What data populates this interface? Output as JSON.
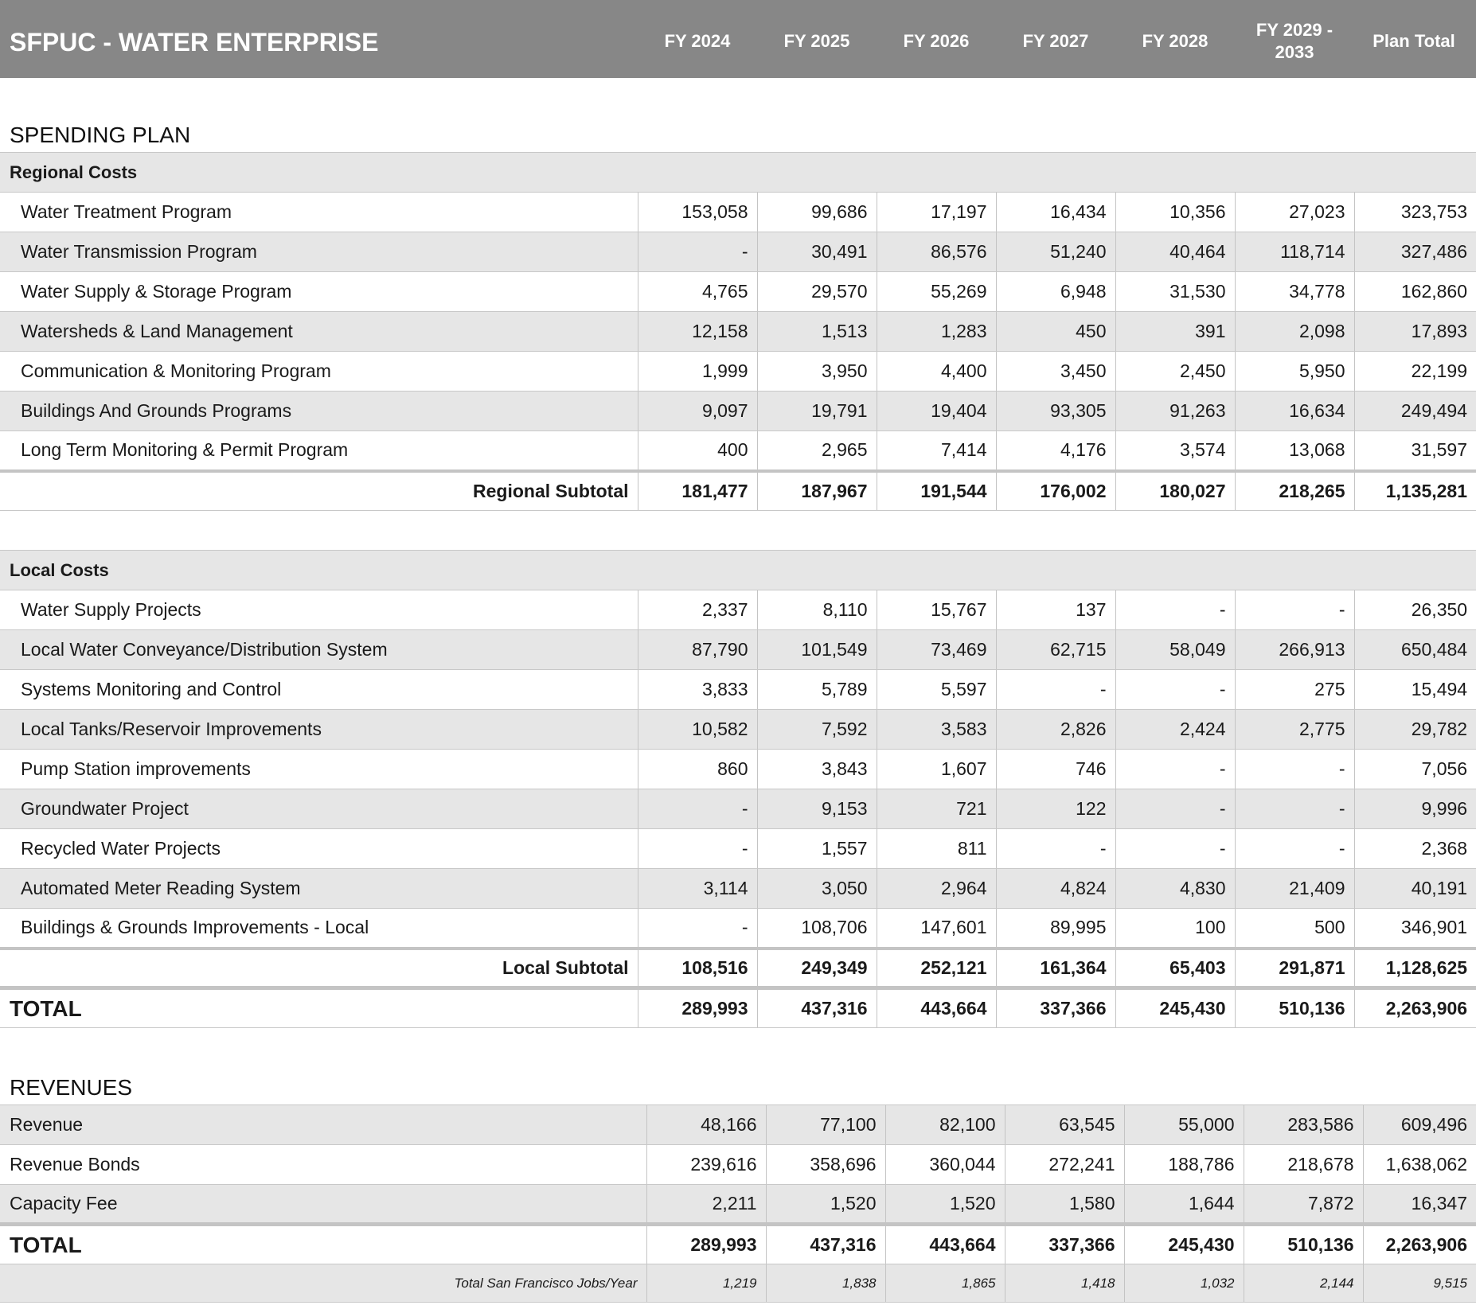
{
  "header": {
    "title": "SFPUC - WATER ENTERPRISE",
    "years": [
      "FY 2024",
      "FY 2025",
      "FY 2026",
      "FY 2027",
      "FY 2028",
      "FY 2029 - 2033",
      "Plan Total"
    ]
  },
  "spending": {
    "title": "SPENDING PLAN",
    "regional": {
      "heading": "Regional Costs",
      "rows": [
        {
          "label": "Water Treatment Program",
          "values": [
            "153,058",
            "99,686",
            "17,197",
            "16,434",
            "10,356",
            "27,023",
            "323,753"
          ]
        },
        {
          "label": "Water Transmission Program",
          "values": [
            "-",
            "30,491",
            "86,576",
            "51,240",
            "40,464",
            "118,714",
            "327,486"
          ]
        },
        {
          "label": "Water Supply & Storage Program",
          "values": [
            "4,765",
            "29,570",
            "55,269",
            "6,948",
            "31,530",
            "34,778",
            "162,860"
          ]
        },
        {
          "label": "Watersheds & Land Management",
          "values": [
            "12,158",
            "1,513",
            "1,283",
            "450",
            "391",
            "2,098",
            "17,893"
          ]
        },
        {
          "label": "Communication & Monitoring Program",
          "values": [
            "1,999",
            "3,950",
            "4,400",
            "3,450",
            "2,450",
            "5,950",
            "22,199"
          ]
        },
        {
          "label": "Buildings And Grounds Programs",
          "values": [
            "9,097",
            "19,791",
            "19,404",
            "93,305",
            "91,263",
            "16,634",
            "249,494"
          ]
        },
        {
          "label": "Long Term Monitoring & Permit Program",
          "values": [
            "400",
            "2,965",
            "7,414",
            "4,176",
            "3,574",
            "13,068",
            "31,597"
          ]
        }
      ],
      "subtotal": {
        "label": "Regional Subtotal",
        "values": [
          "181,477",
          "187,967",
          "191,544",
          "176,002",
          "180,027",
          "218,265",
          "1,135,281"
        ]
      }
    },
    "local": {
      "heading": "Local Costs",
      "rows": [
        {
          "label": "Water Supply Projects",
          "values": [
            "2,337",
            "8,110",
            "15,767",
            "137",
            "-",
            "-",
            "26,350"
          ]
        },
        {
          "label": "Local Water Conveyance/Distribution System",
          "values": [
            "87,790",
            "101,549",
            "73,469",
            "62,715",
            "58,049",
            "266,913",
            "650,484"
          ]
        },
        {
          "label": "Systems Monitoring and Control",
          "values": [
            "3,833",
            "5,789",
            "5,597",
            "-",
            "-",
            "275",
            "15,494"
          ]
        },
        {
          "label": "Local Tanks/Reservoir Improvements",
          "values": [
            "10,582",
            "7,592",
            "3,583",
            "2,826",
            "2,424",
            "2,775",
            "29,782"
          ]
        },
        {
          "label": "Pump Station improvements",
          "values": [
            "860",
            "3,843",
            "1,607",
            "746",
            "-",
            "-",
            "7,056"
          ]
        },
        {
          "label": "Groundwater Project",
          "values": [
            "-",
            "9,153",
            "721",
            "122",
            "-",
            "-",
            "9,996"
          ]
        },
        {
          "label": "Recycled Water Projects",
          "values": [
            "-",
            "1,557",
            "811",
            "-",
            "-",
            "-",
            "2,368"
          ]
        },
        {
          "label": "Automated Meter Reading System",
          "values": [
            "3,114",
            "3,050",
            "2,964",
            "4,824",
            "4,830",
            "21,409",
            "40,191"
          ]
        },
        {
          "label": "Buildings & Grounds Improvements - Local",
          "values": [
            "-",
            "108,706",
            "147,601",
            "89,995",
            "100",
            "500",
            "346,901"
          ]
        }
      ],
      "subtotal": {
        "label": "Local Subtotal",
        "values": [
          "108,516",
          "249,349",
          "252,121",
          "161,364",
          "65,403",
          "291,871",
          "1,128,625"
        ]
      }
    },
    "total": {
      "label": "TOTAL",
      "values": [
        "289,993",
        "437,316",
        "443,664",
        "337,366",
        "245,430",
        "510,136",
        "2,263,906"
      ]
    }
  },
  "revenues": {
    "title": "REVENUES",
    "rows": [
      {
        "label": "Revenue",
        "values": [
          "48,166",
          "77,100",
          "82,100",
          "63,545",
          "55,000",
          "283,586",
          "609,496"
        ]
      },
      {
        "label": "Revenue Bonds",
        "values": [
          "239,616",
          "358,696",
          "360,044",
          "272,241",
          "188,786",
          "218,678",
          "1,638,062"
        ]
      },
      {
        "label": "Capacity Fee",
        "values": [
          "2,211",
          "1,520",
          "1,520",
          "1,580",
          "1,644",
          "7,872",
          "16,347"
        ]
      }
    ],
    "total": {
      "label": "TOTAL",
      "values": [
        "289,993",
        "437,316",
        "443,664",
        "337,366",
        "245,430",
        "510,136",
        "2,263,906"
      ]
    },
    "jobs": {
      "label": "Total San Francisco Jobs/Year",
      "values": [
        "1,219",
        "1,838",
        "1,865",
        "1,418",
        "1,032",
        "2,144",
        "9,515"
      ]
    }
  }
}
